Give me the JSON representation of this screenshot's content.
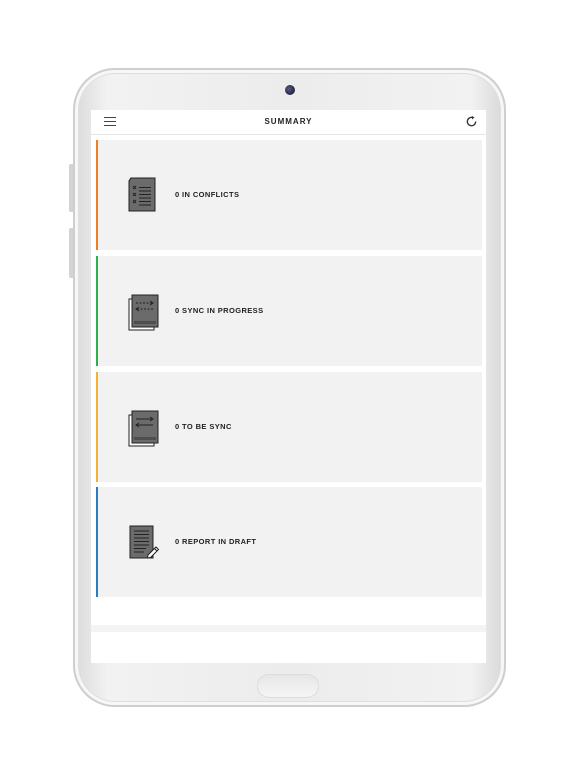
{
  "header": {
    "title": "SUMMARY"
  },
  "icons": {
    "menu": "hamburger-menu-icon",
    "refresh": "refresh-icon"
  },
  "cards": [
    {
      "label": "0 IN CONFLICTS",
      "count": 0,
      "color": "#f07d1e",
      "icon": "conflicts-document-icon"
    },
    {
      "label": "0 SYNC IN PROGRESS",
      "count": 0,
      "color": "#2bb04a",
      "icon": "sync-in-progress-icon"
    },
    {
      "label": "0 TO BE SYNC",
      "count": 0,
      "color": "#f3b233",
      "icon": "to-be-synced-icon"
    },
    {
      "label": "0 REPORT IN DRAFT",
      "count": 0,
      "color": "#2a7bc0",
      "icon": "report-draft-icon"
    }
  ]
}
